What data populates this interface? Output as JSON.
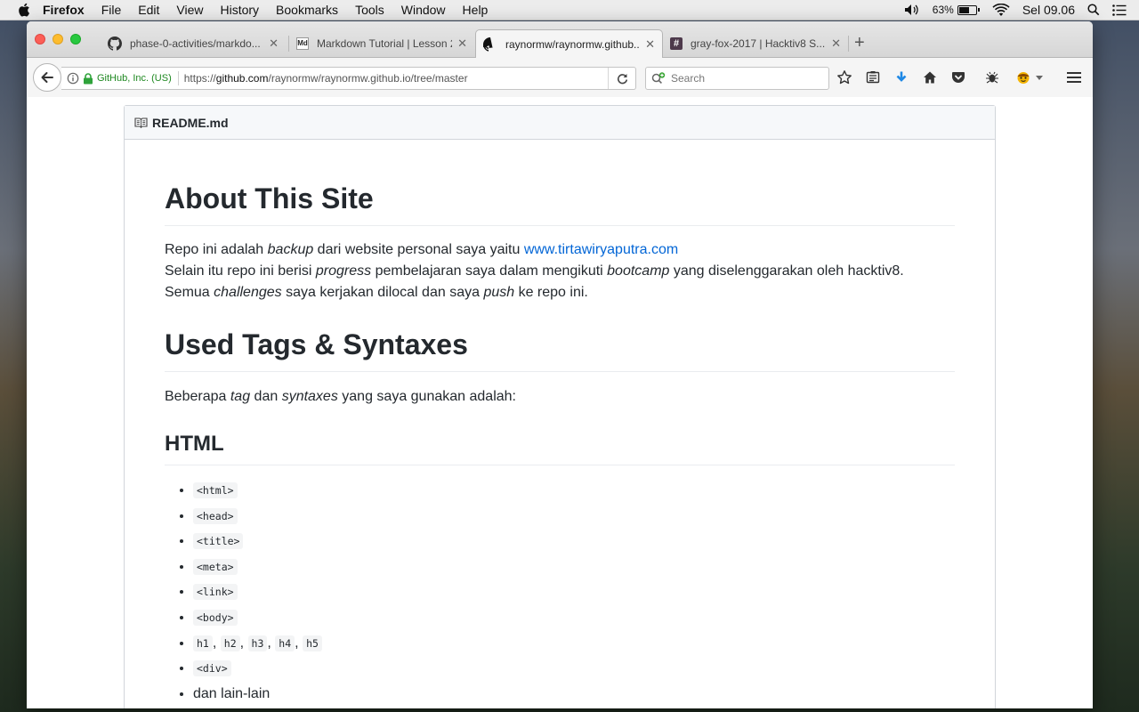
{
  "menubar": {
    "app": "Firefox",
    "items": [
      "File",
      "Edit",
      "View",
      "History",
      "Bookmarks",
      "Tools",
      "Window",
      "Help"
    ],
    "battery": "63%",
    "battery_level": 0.63,
    "clock": "Sel 09.06"
  },
  "tabs": [
    {
      "title": "phase-0-activities/markdo...",
      "favicon": "github-icon"
    },
    {
      "title": "Markdown Tutorial | Lesson 2",
      "favicon": "md-icon",
      "favicon_text": "Md"
    },
    {
      "title": "raynormw/raynormw.github...",
      "favicon": "github-icon",
      "active": true
    },
    {
      "title": "gray-fox-2017 | Hacktiv8 S...",
      "favicon": "slack-hash-icon",
      "favicon_text": "#"
    }
  ],
  "urlbar": {
    "identity": "GitHub, Inc. (US)",
    "url_scheme": "https://",
    "url_host": "github.com",
    "url_path": "/raynormw/raynormw.github.io/tree/master"
  },
  "search": {
    "placeholder": "Search"
  },
  "readme": {
    "filename": "README.md",
    "h1": "About This Site",
    "intro": {
      "l1_a": "Repo ini adalah ",
      "l1_b": "backup",
      "l1_c": " dari website personal saya yaitu ",
      "l1_link": "www.tirtawiryaputra.com",
      "l2_a": "Selain itu repo ini berisi ",
      "l2_b": "progress",
      "l2_c": " pembelajaran saya dalam mengikuti ",
      "l2_d": "bootcamp",
      "l2_e": " yang diselenggarakan oleh hacktiv8.",
      "l3_a": "Semua ",
      "l3_b": "challenges",
      "l3_c": " saya kerjakan dilocal dan saya ",
      "l3_d": "push",
      "l3_e": " ke repo ini."
    },
    "h2": "Used Tags & Syntaxes",
    "tags_intro": {
      "a": "Beberapa ",
      "b": "tag",
      "c": " dan ",
      "d": "syntaxes",
      "e": " yang saya gunakan adalah:"
    },
    "h3": "HTML",
    "list": [
      "<html>",
      "<head>",
      "<title>",
      "<meta>",
      "<link>",
      "<body>"
    ],
    "headings": [
      "h1",
      "h2",
      "h3",
      "h4",
      "h5"
    ],
    "heading_sep": ",",
    "div_item": "<div>",
    "last_item": "dan lain-lain"
  }
}
